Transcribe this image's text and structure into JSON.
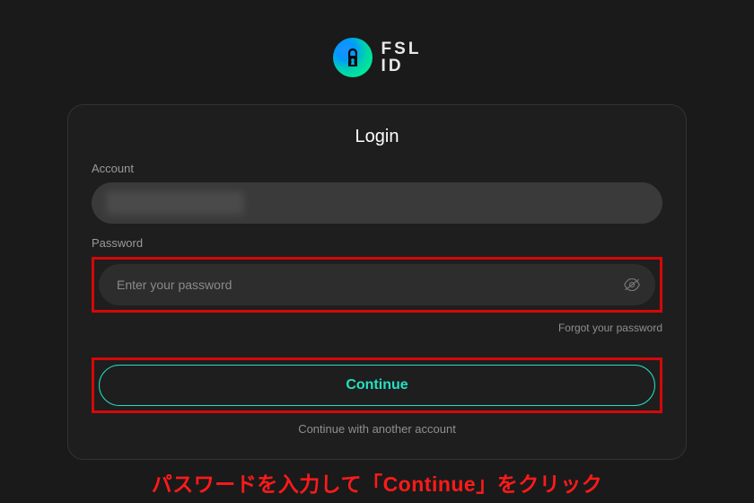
{
  "brand": {
    "line1": "FSL",
    "line2": "ID"
  },
  "card": {
    "title": "Login",
    "account_label": "Account",
    "account_value": "",
    "password_label": "Password",
    "password_placeholder": "Enter your password",
    "forgot_label": "Forgot your password",
    "continue_label": "Continue",
    "alt_account_label": "Continue with another account"
  },
  "annotation": "パスワードを入力して「Continue」をクリック"
}
